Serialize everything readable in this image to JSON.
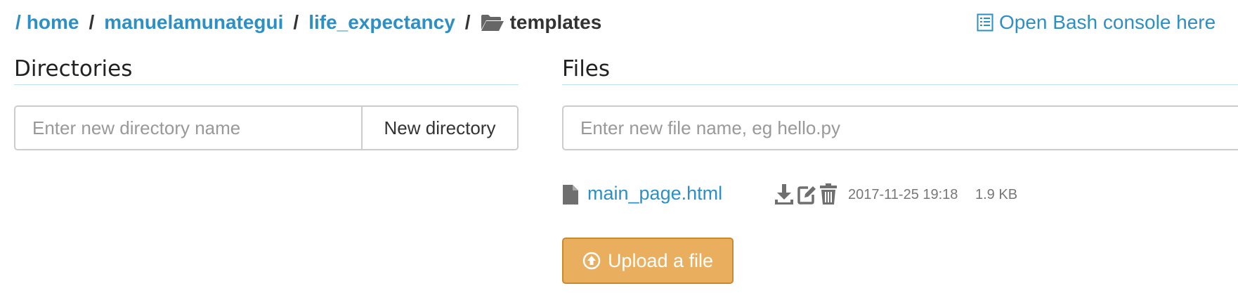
{
  "breadcrumb": {
    "root_separator": "/",
    "separator": "/",
    "items": [
      {
        "label": "home"
      },
      {
        "label": "manuelamunategui"
      },
      {
        "label": "life_expectancy"
      }
    ],
    "current": "templates",
    "current_icon": "folder-open-icon"
  },
  "bash_console": {
    "label": "Open Bash console here",
    "icon": "list-icon"
  },
  "directories": {
    "title": "Directories",
    "input_placeholder": "Enter new directory name",
    "button_label": "New directory"
  },
  "files": {
    "title": "Files",
    "input_placeholder": "Enter new file name, eg hello.py",
    "list": [
      {
        "name": "main_page.html",
        "icon": "file-icon",
        "modified": "2017-11-25 19:18",
        "size": "1.9 KB",
        "actions": [
          "download-icon",
          "edit-icon",
          "trash-icon"
        ]
      }
    ],
    "upload_label": "Upload a file",
    "upload_icon": "upload-circle-icon"
  },
  "colors": {
    "link": "#2d8fc4",
    "upload_button": "#e9af5f",
    "upload_border": "#c98a2c",
    "section_rule": "#bfe0ef"
  }
}
